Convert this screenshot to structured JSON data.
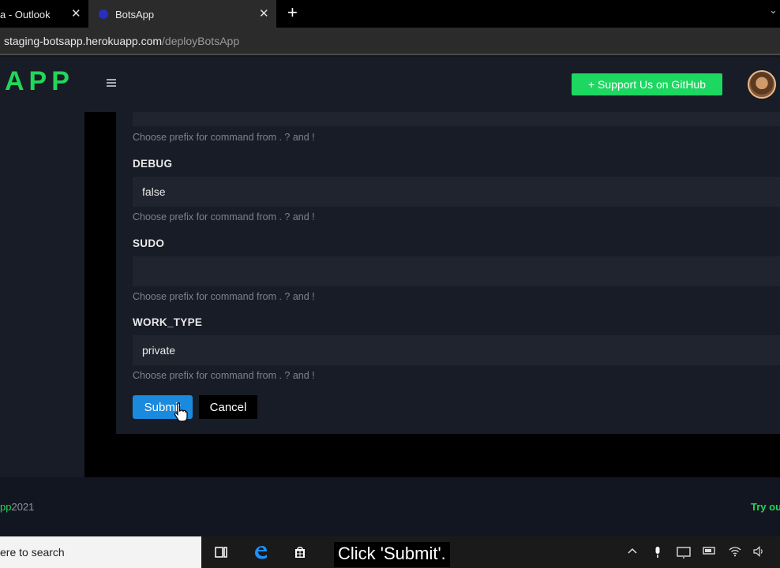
{
  "browser": {
    "tabs": [
      {
        "title": "a - Outlook",
        "close": "✕"
      },
      {
        "title": "BotsApp",
        "close": "✕"
      }
    ],
    "new_tab": "+",
    "tab_menu": "⌄",
    "url_host": "staging-botsapp.herokuapp.com",
    "url_path": "/deployBotsApp"
  },
  "header": {
    "brand": "APP",
    "github_button": "+ Support Us on GitHub"
  },
  "form": {
    "fields": [
      {
        "label": "",
        "value": "",
        "hint": "Choose prefix for command from . ? and !"
      },
      {
        "label": "DEBUG",
        "value": "false",
        "hint": "Choose prefix for command from . ? and !"
      },
      {
        "label": "SUDO",
        "value": "",
        "hint": "Choose prefix for command from . ? and !"
      },
      {
        "label": "WORK_TYPE",
        "value": "private",
        "hint": "Choose prefix for command from . ? and !"
      }
    ],
    "submit_label": "Submit",
    "cancel_label": "Cancel"
  },
  "footer": {
    "left_brand": "pp",
    "left_year": "2021",
    "right_text": "Try ou"
  },
  "taskbar": {
    "search_text": "ere to search",
    "caption": "Click 'Submit'."
  },
  "colors": {
    "accent_green": "#22d65a",
    "submit_blue": "#1a8adf",
    "card_bg": "#181c26"
  }
}
